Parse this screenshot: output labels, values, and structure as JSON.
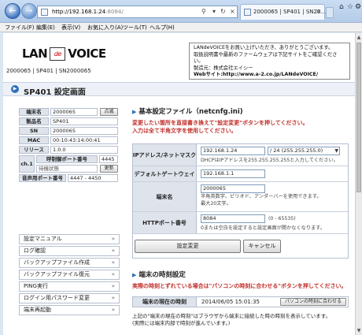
{
  "browser": {
    "url_host": "http://192.168.1.24",
    "url_rest": ":8084/",
    "tab_title": "2000065 | SP401 | SN20...",
    "menu": [
      "ファイル(F)",
      "編集(E)",
      "表示(V)",
      "お気に入り(A)",
      "ツール(T)",
      "ヘルプ(H)"
    ]
  },
  "brand": {
    "lan": "LAN",
    "de": "de",
    "voice": "VOICE"
  },
  "header": {
    "version_line": "2000065 | SP401 | SN2000065",
    "notice_lines": [
      "LANdeVOICEをお買い上げいただき、ありがとうございます。",
      "取扱説明書や最新のファームウェアは下記サイトをご確認ください。",
      "製造元：株式会社エイシー"
    ],
    "notice_web_label": "Webサイト",
    "notice_web_url": ":http://www.a-2.co.jp/LANdeVOICE/"
  },
  "page_title": "SP401 設定画面",
  "info": {
    "terminal_name_label": "端末名",
    "terminal_name_value": "2000065",
    "check_button": "点滅",
    "product_label": "製品名",
    "product_value": "SP401",
    "sn_label": "SN",
    "sn_value": "2000065",
    "mac_label": "MAC",
    "mac_value": "00:10:43:14:00:41",
    "release_label": "リリース",
    "release_value": "1.0.0",
    "ch_label": "ch.1",
    "call_port_label": "呼制御ポート番号",
    "call_port_value": "4445",
    "status_value": "待機状態",
    "refresh_button": "更新",
    "audio_port_label": "音声用ポート番号",
    "audio_port_value": "4447 - 4450"
  },
  "left_nav": [
    "設定マニュアル",
    "ログ確認",
    "バックアップファイル作成",
    "バックアップファイル復元",
    "PING実行",
    "ログイン用パスワード変更",
    "端末再起動"
  ],
  "basic": {
    "title": "基本設定ファイル（netcnfg.ini)",
    "instruction_1": "変更したい箇所を直接書き換えて\"設定変更\"ボタンを押してください。",
    "instruction_2": "入力は全て半角文字を使用してください。",
    "ip_label": "IPアドレス/ネットマスク",
    "ip_value": "192.168.1.24",
    "mask_value": "/ 24 (255.255.255.0)",
    "ip_note": "DHCPはIPアドレスを255.255.255.255と入力してください。",
    "gateway_label": "デフォルトゲートウェイ",
    "gateway_value": "192.168.1.1",
    "name_label": "端末名",
    "name_value": "2000065",
    "name_note_1": "半角英数字、ピリオド、アンダーバーを使用できます。",
    "name_note_2": "最大20文字。",
    "http_label": "HTTPポート番号",
    "http_value": "8084",
    "http_range": "(0 - 65535)",
    "http_note": "0または空白を設定すると設定画面が開かなくなります。",
    "apply_button": "設定変更",
    "cancel_button": "キャンセル"
  },
  "time": {
    "title": "端末の時刻設定",
    "instruction": "実際の時刻とずれている場合は\"パソコンの時刻に合わせる\"ボタンを押してください。",
    "current_label": "端末の現在の時刻",
    "current_value": "2014/06/05 15:01:35",
    "sync_button": "パソコンの時刻に合わせる",
    "footer_1": "上記の\"端末の現在の時刻\"はブラウザから端末に接続した時の時刻を表示しています。",
    "footer_2": "(実際には端末内部で時刻が進んでいます。)"
  }
}
